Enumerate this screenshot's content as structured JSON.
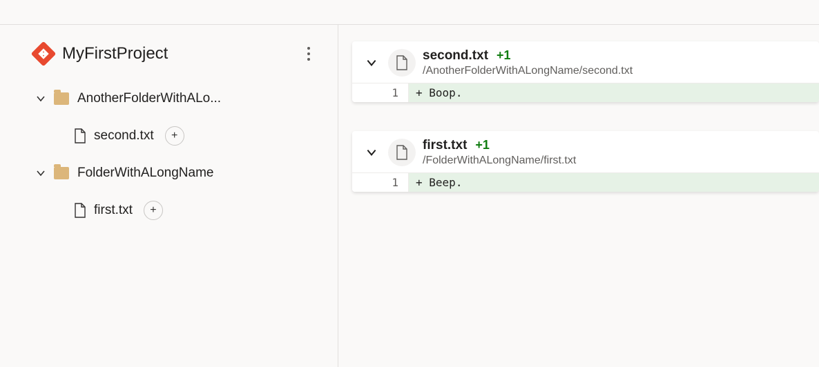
{
  "project": {
    "name": "MyFirstProject"
  },
  "tree": {
    "folders": [
      {
        "label": "AnotherFolderWithALo...",
        "files": [
          {
            "label": "second.txt",
            "badge": "+"
          }
        ]
      },
      {
        "label": "FolderWithALongName",
        "files": [
          {
            "label": "first.txt",
            "badge": "+"
          }
        ]
      }
    ]
  },
  "diffs": [
    {
      "filename": "second.txt",
      "delta": "+1",
      "path": "/AnotherFolderWithALongName/second.txt",
      "line_no": "1",
      "line_prefix": "+",
      "line_text": "Boop."
    },
    {
      "filename": "first.txt",
      "delta": "+1",
      "path": "/FolderWithALongName/first.txt",
      "line_no": "1",
      "line_prefix": "+",
      "line_text": "Beep."
    }
  ]
}
